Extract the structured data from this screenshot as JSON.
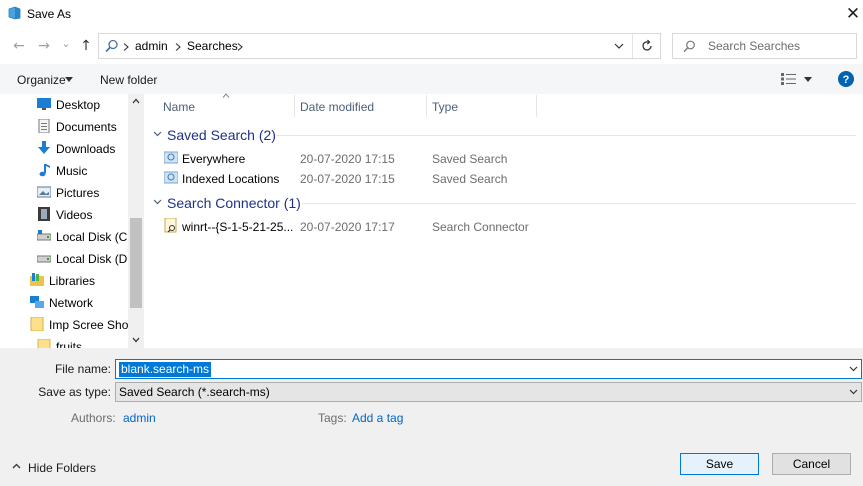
{
  "window": {
    "title": "Save As",
    "close_glyph": "✕"
  },
  "nav": {
    "back_glyph": "←",
    "forward_glyph": "→",
    "recent_glyph": "⌄",
    "up_glyph": "↑",
    "breadcrumb": [
      "admin",
      "Searches"
    ],
    "search_placeholder": "Search Searches"
  },
  "toolbar": {
    "organize_label": "Organize",
    "new_folder_label": "New folder"
  },
  "sidebar": {
    "items": [
      {
        "label": "Desktop",
        "icon": "desktop-icon"
      },
      {
        "label": "Documents",
        "icon": "documents-icon"
      },
      {
        "label": "Downloads",
        "icon": "downloads-icon"
      },
      {
        "label": "Music",
        "icon": "music-icon"
      },
      {
        "label": "Pictures",
        "icon": "pictures-icon"
      },
      {
        "label": "Videos",
        "icon": "videos-icon"
      },
      {
        "label": "Local Disk (C:)",
        "icon": "drive-icon"
      },
      {
        "label": "Local Disk (D:)",
        "icon": "drive-icon"
      },
      {
        "label": "Libraries",
        "icon": "libraries-icon"
      },
      {
        "label": "Network",
        "icon": "network-icon"
      },
      {
        "label": "Imp Scree Shots",
        "icon": "folder-icon"
      },
      {
        "label": "fruits",
        "icon": "folder-icon"
      }
    ]
  },
  "columns": {
    "name": "Name",
    "date": "Date modified",
    "type": "Type"
  },
  "groups": [
    {
      "title": "Saved Search (2)",
      "rows": [
        {
          "name": "Everywhere",
          "date": "20-07-2020 17:15",
          "type": "Saved Search"
        },
        {
          "name": "Indexed Locations",
          "date": "20-07-2020 17:15",
          "type": "Saved Search"
        }
      ]
    },
    {
      "title": "Search Connector (1)",
      "rows": [
        {
          "name": "winrt--{S-1-5-21-25...",
          "date": "20-07-2020 17:17",
          "type": "Search Connector"
        }
      ]
    }
  ],
  "form": {
    "file_name_label": "File name:",
    "file_name_value": "blank.search-ms",
    "save_type_label": "Save as type:",
    "save_type_value": "Saved Search (*.search-ms)",
    "authors_label": "Authors:",
    "authors_value": "admin",
    "tags_label": "Tags:",
    "tags_value": "Add a tag"
  },
  "footer": {
    "hide_folders_label": "Hide Folders",
    "save_label": "Save",
    "cancel_label": "Cancel"
  },
  "colors": {
    "accent": "#0078d7",
    "group_title": "#1e3287",
    "link": "#0066cc",
    "help": "#0063b1"
  }
}
